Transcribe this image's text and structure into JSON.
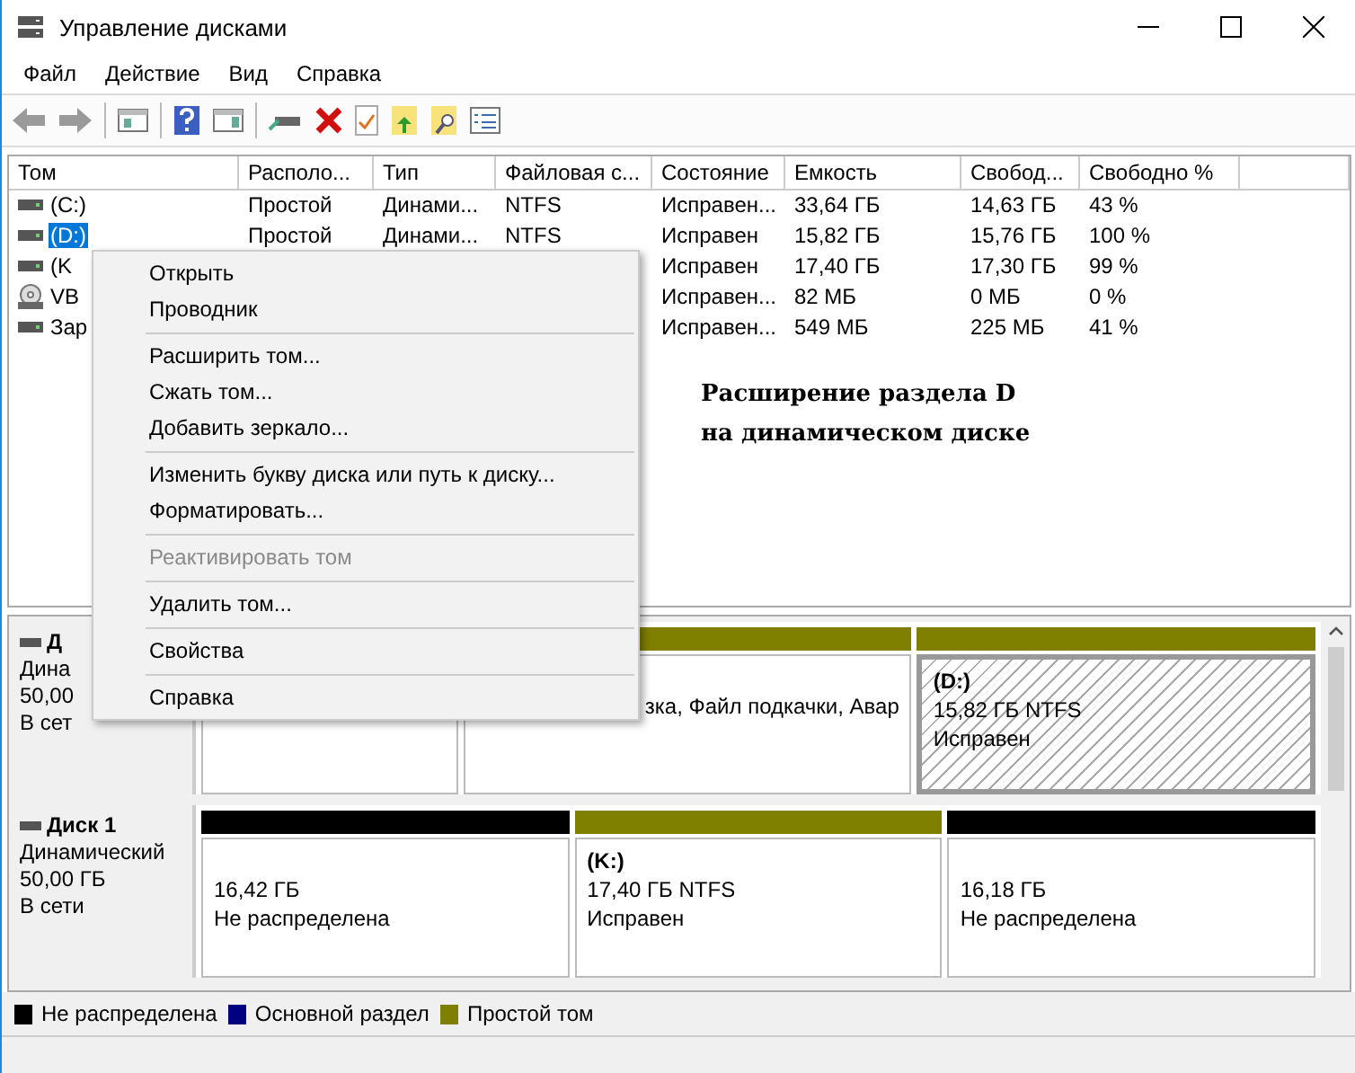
{
  "window": {
    "title": "Управление дисками"
  },
  "menu": [
    "Файл",
    "Действие",
    "Вид",
    "Справка"
  ],
  "toolbar": [
    {
      "kind": "back"
    },
    {
      "kind": "forward"
    },
    {
      "kind": "sep"
    },
    {
      "kind": "tree"
    },
    {
      "kind": "sep"
    },
    {
      "kind": "help"
    },
    {
      "kind": "panel"
    },
    {
      "kind": "sep"
    },
    {
      "kind": "connect"
    },
    {
      "kind": "delete"
    },
    {
      "kind": "check"
    },
    {
      "kind": "folder-up"
    },
    {
      "kind": "folder-search"
    },
    {
      "kind": "list"
    }
  ],
  "volumes": {
    "columns": [
      "Том",
      "Располо...",
      "Тип",
      "Файловая с...",
      "Состояние",
      "Емкость",
      "Свобод...",
      "Свободно %"
    ],
    "rows": [
      {
        "kind": "disk",
        "selected": false,
        "cells": [
          "(C:)",
          "Простой",
          "Динами...",
          "NTFS",
          "Исправен...",
          "33,64 ГБ",
          "14,63 ГБ",
          "43 %"
        ]
      },
      {
        "kind": "disk",
        "selected": true,
        "cells": [
          "(D:)",
          "Простой",
          "Динами...",
          "NTFS",
          "Исправен",
          "15,82 ГБ",
          "15,76 ГБ",
          "100 %"
        ]
      },
      {
        "kind": "disk",
        "selected": false,
        "cells": [
          "(K",
          null,
          null,
          null,
          "Исправен",
          "17,40 ГБ",
          "17,30 ГБ",
          "99 %"
        ]
      },
      {
        "kind": "cd",
        "selected": false,
        "cells": [
          "VB",
          null,
          null,
          null,
          "Исправен...",
          "82 МБ",
          "0 МБ",
          "0 %"
        ]
      },
      {
        "kind": "disk",
        "selected": false,
        "cells": [
          "Зар",
          null,
          null,
          null,
          "Исправен...",
          "549 МБ",
          "225 МБ",
          "41 %"
        ]
      }
    ]
  },
  "annotation": [
    "Расширение раздела D",
    "на динамическом диске"
  ],
  "disks": [
    {
      "name": "Д",
      "lines": [
        "Дина",
        "50,00",
        "В сет"
      ],
      "partitions": [
        {
          "selected": false
        },
        {
          "kind": "simple",
          "selected": false,
          "lines": [
            "зка, Файл подкачки, Авар"
          ]
        },
        {
          "kind": "simple",
          "selected": true,
          "title": "(D:)",
          "lines": [
            "15,82 ГБ NTFS",
            "Исправен"
          ]
        }
      ]
    },
    {
      "name": "Диск 1",
      "lines": [
        "Динамический",
        "50,00 ГБ",
        "В сети"
      ],
      "partitions": [
        {
          "kind": "unallocated",
          "selected": false,
          "lines": [
            "16,42 ГБ",
            "Не распределена"
          ]
        },
        {
          "kind": "simple",
          "selected": false,
          "title": "(K:)",
          "lines": [
            "17,40 ГБ NTFS",
            "Исправен"
          ]
        },
        {
          "kind": "unallocated",
          "selected": false,
          "lines": [
            "16,18 ГБ",
            "Не распределена"
          ]
        }
      ]
    }
  ],
  "legend": [
    {
      "label": "Не распределена",
      "color": "#000000"
    },
    {
      "label": "Основной раздел",
      "color": "#000080"
    },
    {
      "label": "Простой том",
      "color": "#808000"
    }
  ],
  "context_menu": [
    {
      "kind": "item",
      "label": "Открыть",
      "disabled": false
    },
    {
      "kind": "item",
      "label": "Проводник",
      "disabled": false
    },
    {
      "kind": "separator"
    },
    {
      "kind": "item",
      "label": "Расширить том...",
      "disabled": false
    },
    {
      "kind": "item",
      "label": "Сжать том...",
      "disabled": false
    },
    {
      "kind": "item",
      "label": "Добавить зеркало...",
      "disabled": false
    },
    {
      "kind": "separator"
    },
    {
      "kind": "item",
      "label": "Изменить букву диска или путь к диску...",
      "disabled": false
    },
    {
      "kind": "item",
      "label": "Форматировать...",
      "disabled": false
    },
    {
      "kind": "separator"
    },
    {
      "kind": "item",
      "label": "Реактивировать том",
      "disabled": true
    },
    {
      "kind": "separator"
    },
    {
      "kind": "item",
      "label": "Удалить том...",
      "disabled": false
    },
    {
      "kind": "separator"
    },
    {
      "kind": "item",
      "label": "Свойства",
      "disabled": false
    },
    {
      "kind": "separator"
    },
    {
      "kind": "item",
      "label": "Справка",
      "disabled": false
    }
  ]
}
